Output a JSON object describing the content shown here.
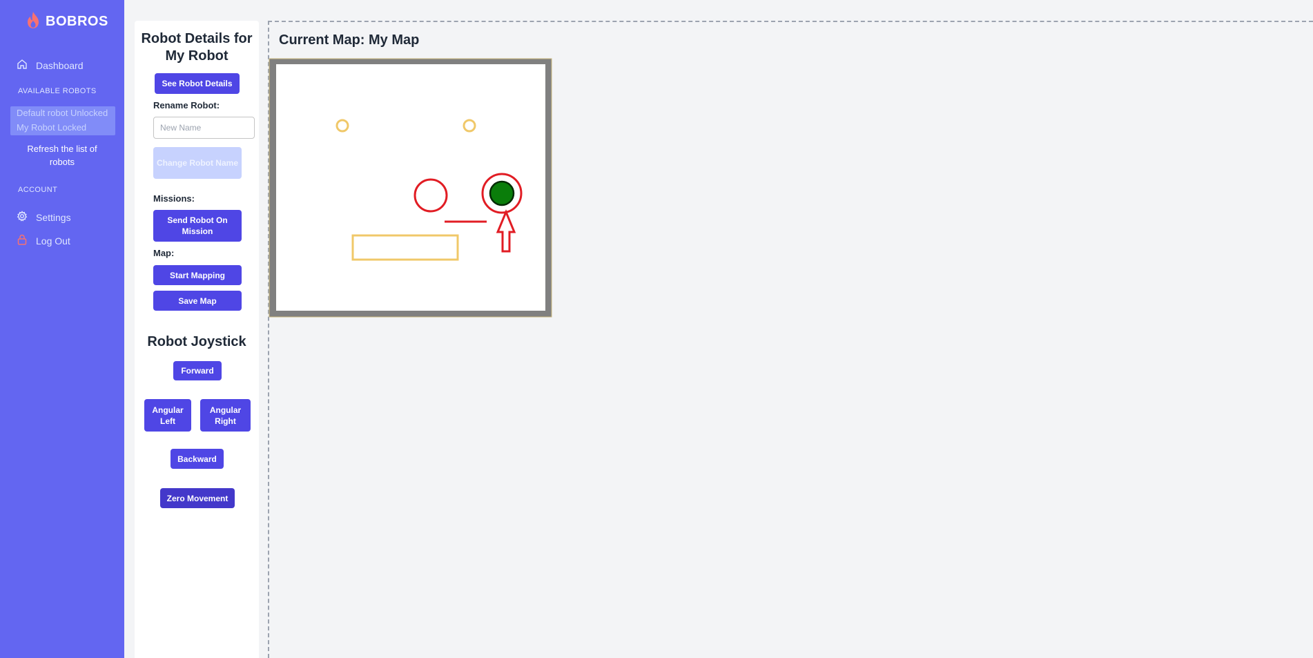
{
  "brand": {
    "name": "BOBROS",
    "icon": "flame-icon"
  },
  "sidebar": {
    "dashboard": {
      "label": "Dashboard",
      "icon": "home-icon"
    },
    "available_robots_heading": "AVAILABLE ROBOTS",
    "robots": [
      {
        "label": "Default robot Unlocked"
      },
      {
        "label": "My Robot Locked"
      }
    ],
    "refresh_label": "Refresh the list of robots",
    "account_heading": "ACCOUNT",
    "settings": {
      "label": "Settings",
      "icon": "gear-icon"
    },
    "logout": {
      "label": "Log Out",
      "icon": "lock-icon"
    }
  },
  "details": {
    "title": "Robot Details for My Robot",
    "see_details_label": "See Robot Details",
    "rename_label": "Rename Robot:",
    "rename_placeholder": "New Name",
    "change_name_label": "Change Robot Name",
    "missions_label": "Missions:",
    "send_mission_label": "Send Robot On Mission",
    "map_label": "Map:",
    "start_mapping_label": "Start Mapping",
    "save_map_label": "Save Map"
  },
  "joystick": {
    "title": "Robot Joystick",
    "forward_label": "Forward",
    "angular_left_label": "Angular Left",
    "angular_right_label": "Angular Right",
    "backward_label": "Backward",
    "zero_label": "Zero Movement"
  },
  "map": {
    "title": "Current Map: My Map",
    "colors": {
      "wall": "#808080",
      "obstacle": "#f0c869",
      "target": "#e11d24",
      "robot": "#0a7d0a"
    }
  }
}
